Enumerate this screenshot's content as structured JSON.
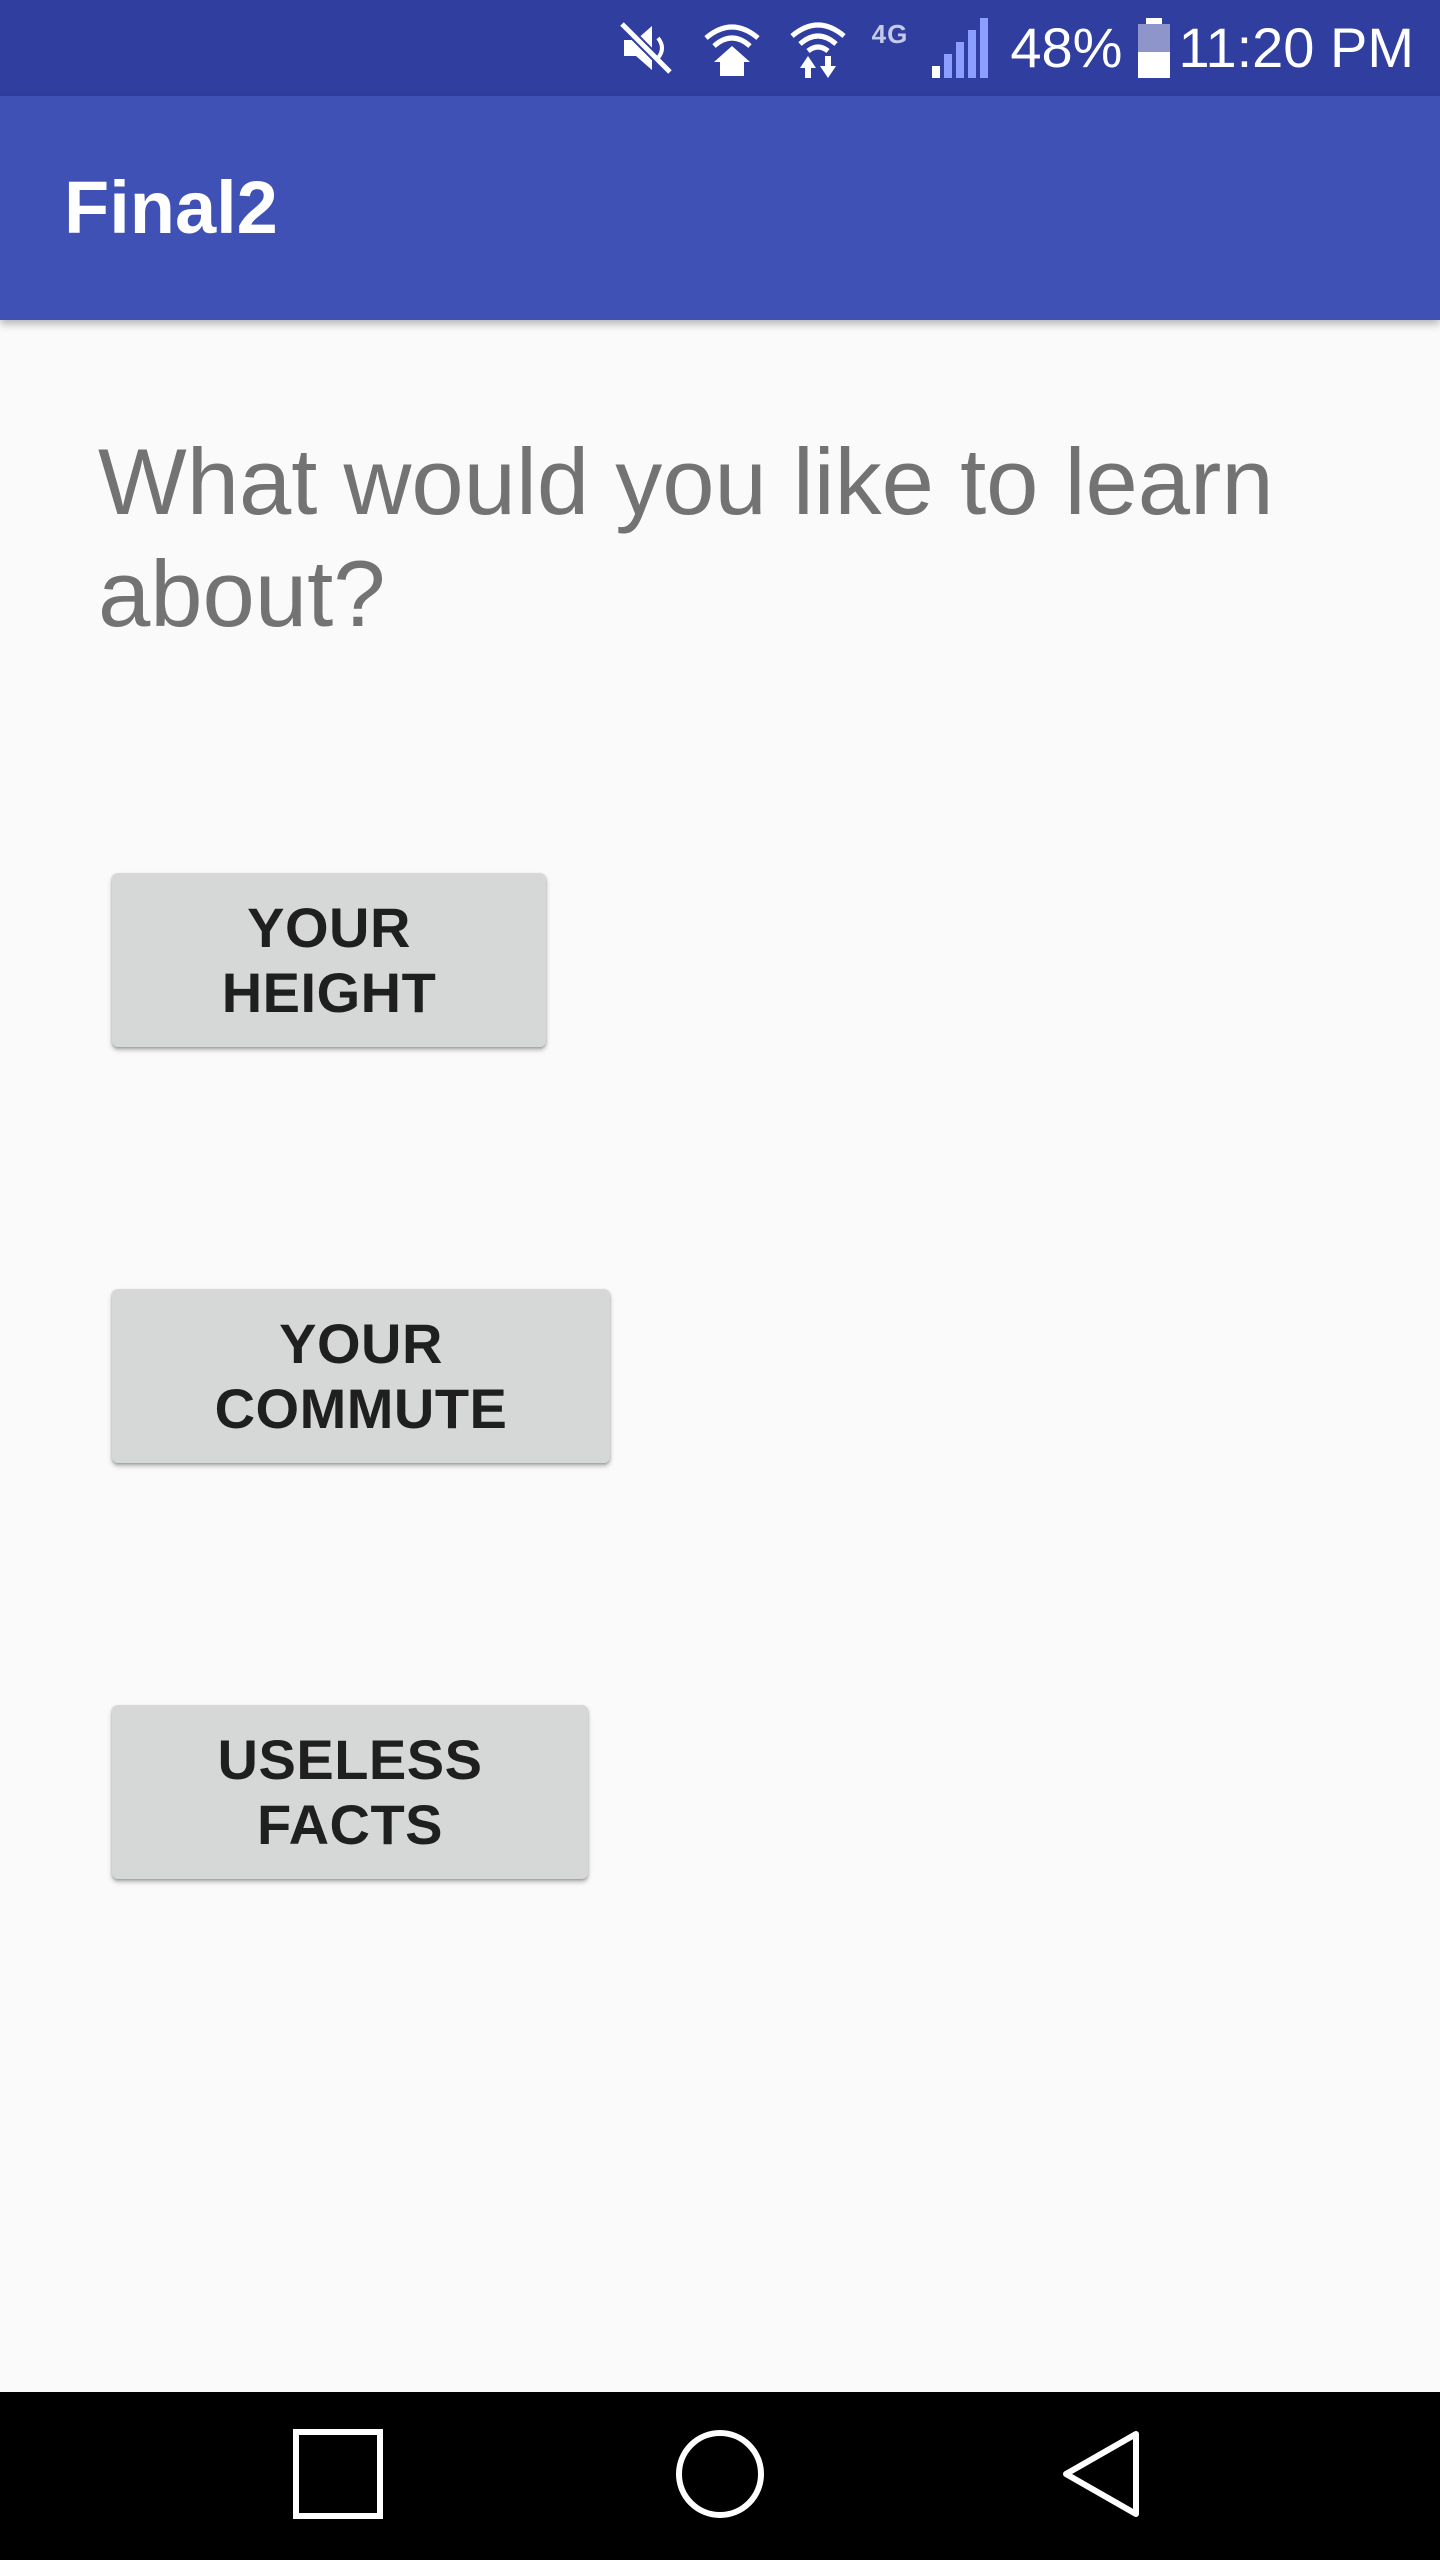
{
  "status_bar": {
    "network_label": "4G",
    "battery_percent": "48%",
    "battery_level": 0.48,
    "time": "11:20 PM",
    "icons": [
      "mute-icon",
      "wifi-home-icon",
      "wifi-data-icon",
      "lte-icon",
      "signal-icon",
      "battery-icon"
    ]
  },
  "app_bar": {
    "title": "Final2"
  },
  "main": {
    "question": "What would you like to learn about?",
    "buttons": [
      {
        "label": "YOUR HEIGHT"
      },
      {
        "label": "YOUR COMMUTE"
      },
      {
        "label": "USELESS FACTS"
      }
    ]
  },
  "nav_bar": {
    "icons": [
      "recents-icon",
      "home-icon",
      "back-icon"
    ]
  },
  "colors": {
    "status_bar": "#303f9f",
    "app_bar": "#3f51b5",
    "background": "#fafafa",
    "button": "#d6d7d7",
    "question_text": "#737373",
    "nav_bar": "#000000"
  }
}
